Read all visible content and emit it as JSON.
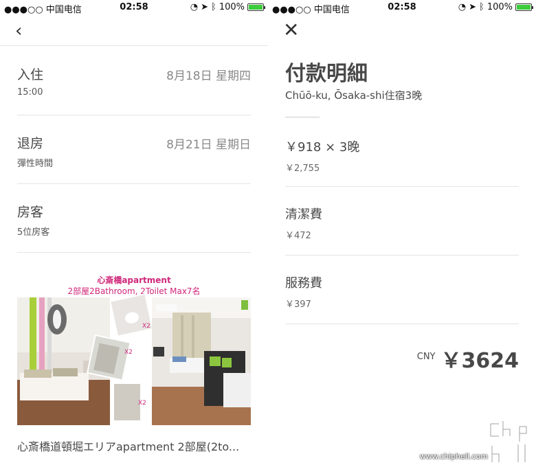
{
  "statusbar": {
    "carrier": "●●●○○ 中国电信",
    "time": "02:58",
    "battery": "100%"
  },
  "left": {
    "checkin": {
      "label": "入住",
      "sub": "15:00",
      "date": "8月18日 星期四"
    },
    "checkout": {
      "label": "退房",
      "sub": "彈性時間",
      "date": "8月21日 星期日"
    },
    "guests": {
      "label": "房客",
      "sub": "5位房客"
    },
    "listing": {
      "image_title": "心斎橋apartment",
      "image_sub": "2部屋2Bathroom, 2Toilet   Max7名",
      "caption": "心斎橋道頓堀エリアapartment 2部屋(2to..."
    }
  },
  "right": {
    "title": "付款明細",
    "subtitle": "Chūō-ku, Ōsaka-shi住宿3晚",
    "nightly": {
      "label": "￥918 × 3晚",
      "amount": "￥2,755"
    },
    "cleaning": {
      "label": "清潔費",
      "amount": "￥472"
    },
    "service": {
      "label": "服務費",
      "amount": "￥397"
    },
    "total": {
      "currency": "CNY",
      "amount": "￥3624"
    }
  },
  "watermark": {
    "url": "www.chiphell.com"
  },
  "colors": {
    "battery": "#3ccc3c",
    "image_text": "#d0267a"
  }
}
